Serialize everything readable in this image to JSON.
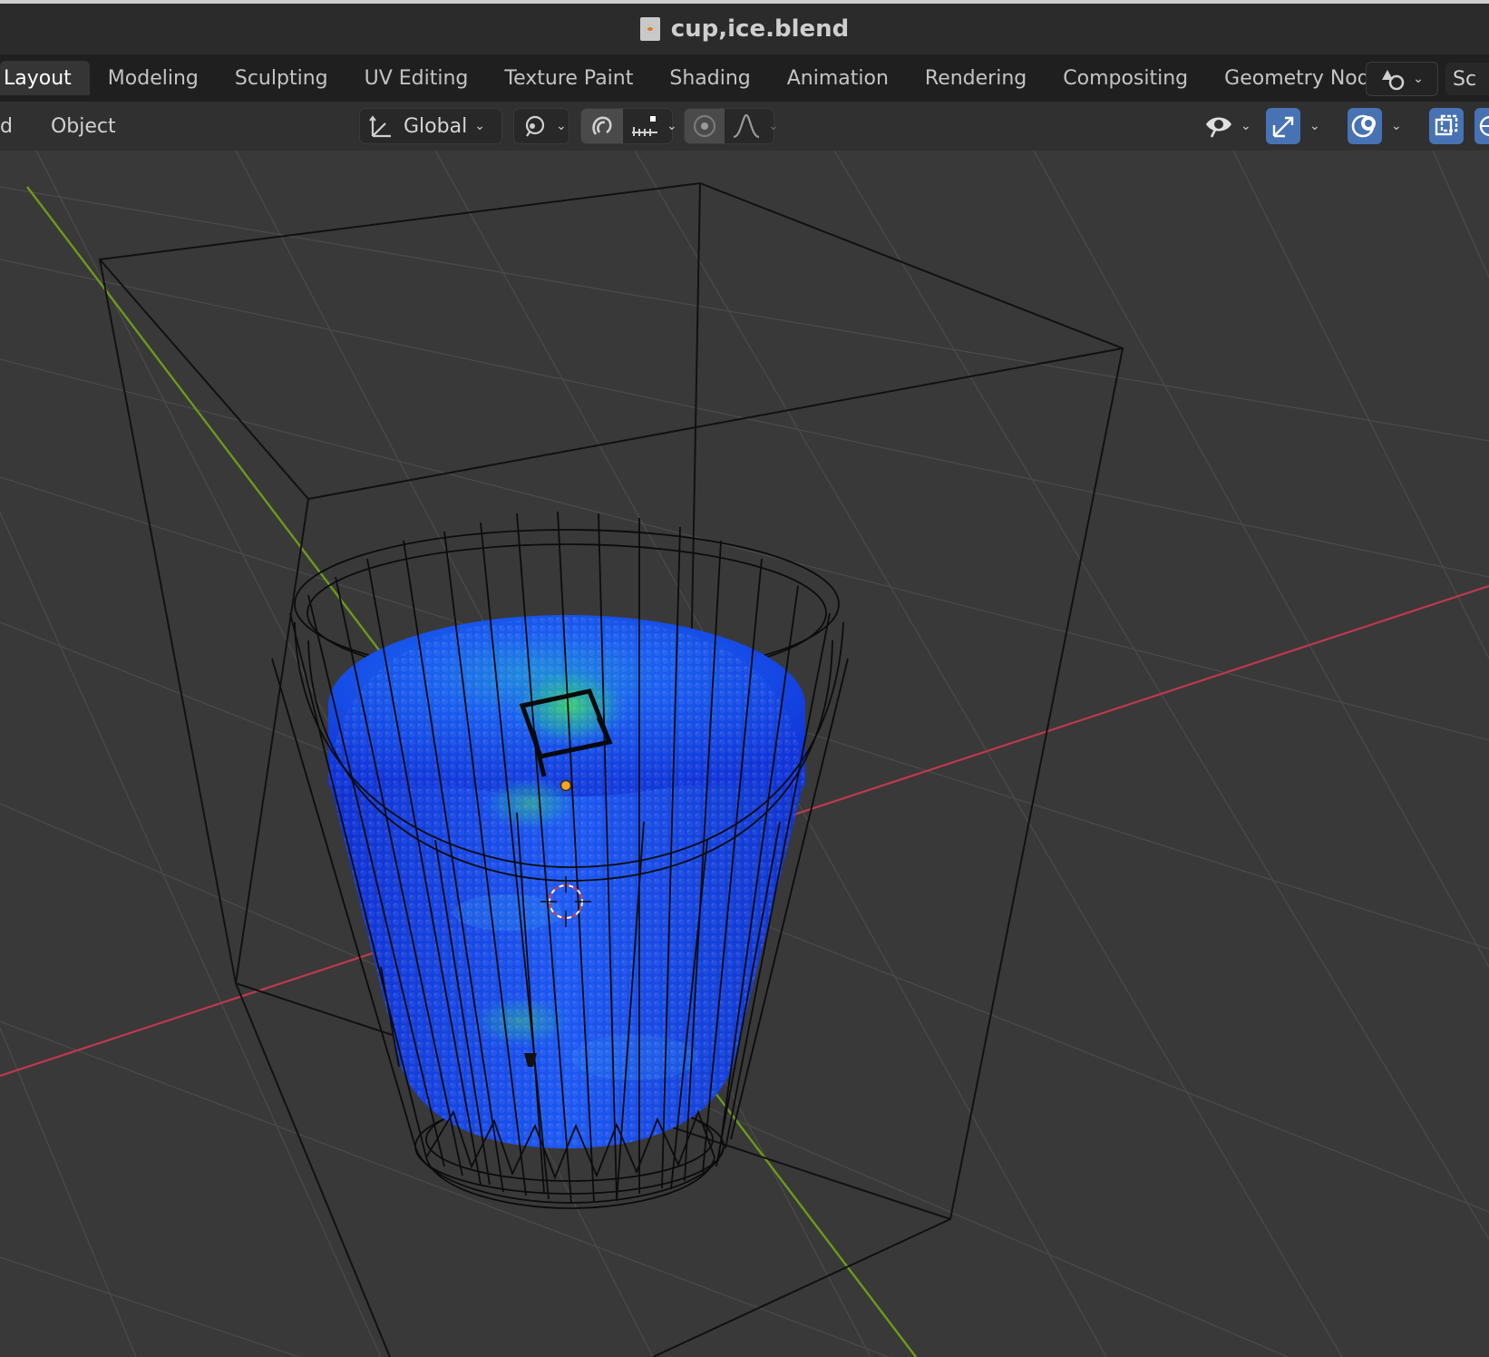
{
  "window": {
    "title": "cup,ice.blend",
    "file_icon": "blend-file-icon"
  },
  "workspaces": {
    "tabs": [
      {
        "label": "Layout",
        "active": true
      },
      {
        "label": "Modeling"
      },
      {
        "label": "Sculpting"
      },
      {
        "label": "UV Editing"
      },
      {
        "label": "Texture Paint"
      },
      {
        "label": "Shading"
      },
      {
        "label": "Animation"
      },
      {
        "label": "Rendering"
      },
      {
        "label": "Compositing"
      },
      {
        "label": "Geometry Nodes"
      }
    ],
    "scene_label": "Sc"
  },
  "header": {
    "menu_left": "d",
    "menu_object": "Object",
    "transform_orientation": "Global",
    "icons": [
      "orientation-icon",
      "pivot-icon",
      "snap-icon",
      "snap-increment-icon",
      "proportional-edit-icon",
      "falloff-icon",
      "visibility-icon",
      "gizmo-icon",
      "overlay-icon",
      "xray-icon"
    ]
  },
  "colors": {
    "accent": "#4772b3",
    "x_axis": "#c0394a",
    "y_axis": "#6c9a1a",
    "fluid": "#1b49e8",
    "fluid_highlight": "#2fd06a"
  }
}
